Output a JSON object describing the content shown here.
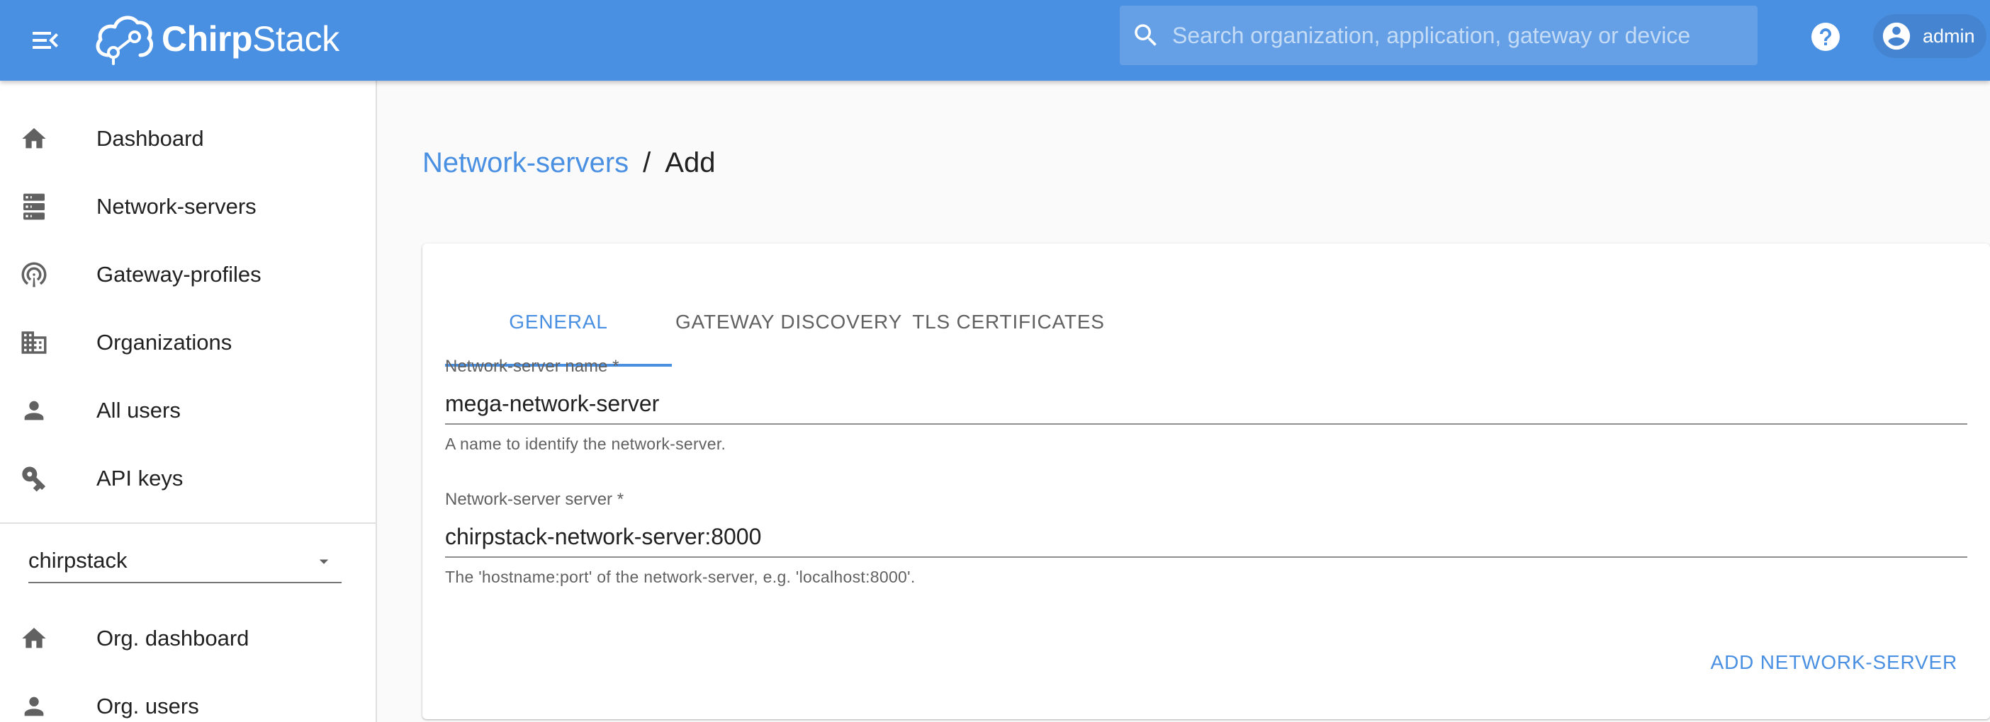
{
  "colors": {
    "primary": "#4a90e2",
    "icon_gray": "#616161"
  },
  "header": {
    "logo_icon": "chirpstack-cloud-logo",
    "logo_text_bold": "Chirp",
    "logo_text_regular": "Stack",
    "search_placeholder": "Search organization, application, gateway or device",
    "search_icon": "search-icon",
    "help_icon": "help-icon",
    "user": {
      "icon": "account-circle-icon",
      "name": "admin"
    }
  },
  "sidebar": {
    "items": [
      {
        "label": "Dashboard",
        "icon": "home-icon"
      },
      {
        "label": "Network-servers",
        "icon": "server-icon"
      },
      {
        "label": "Gateway-profiles",
        "icon": "access-point-icon"
      },
      {
        "label": "Organizations",
        "icon": "domain-icon"
      },
      {
        "label": "All users",
        "icon": "account-icon"
      },
      {
        "label": "API keys",
        "icon": "key-icon"
      }
    ],
    "org_select": {
      "value": "chirpstack",
      "icon": "chevron-down-icon"
    },
    "org_items": [
      {
        "label": "Org. dashboard",
        "icon": "home-icon"
      },
      {
        "label": "Org. users",
        "icon": "account-icon"
      }
    ]
  },
  "breadcrumb": {
    "parent": "Network-servers",
    "separator": "/",
    "current": "Add"
  },
  "tabs": [
    {
      "label": "GENERAL",
      "active": true
    },
    {
      "label": "GATEWAY DISCOVERY",
      "active": false
    },
    {
      "label": "TLS CERTIFICATES",
      "active": false
    }
  ],
  "form": {
    "name_field": {
      "label": "Network-server name *",
      "value": "mega-network-server",
      "help": "A name to identify the network-server."
    },
    "server_field": {
      "label": "Network-server server *",
      "value": "chirpstack-network-server:8000",
      "help": "The 'hostname:port' of the network-server, e.g. 'localhost:8000'."
    },
    "submit_label": "ADD NETWORK-SERVER"
  }
}
